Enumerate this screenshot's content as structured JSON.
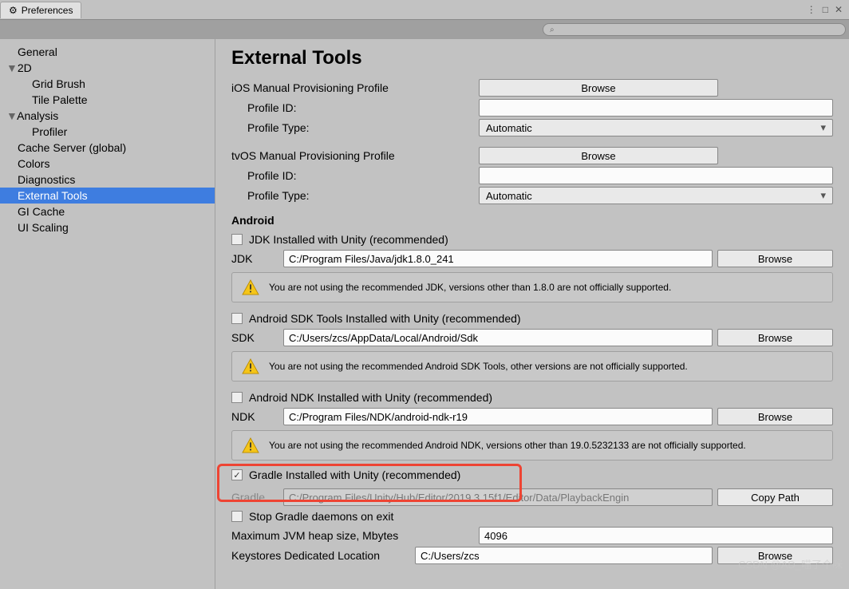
{
  "titlebar": {
    "title": "Preferences",
    "menu": "⋮",
    "max": "□",
    "close": "✕"
  },
  "search": {
    "placeholder": ""
  },
  "sidebar": {
    "items": [
      {
        "label": "General"
      },
      {
        "label": "2D",
        "fold": true
      },
      {
        "label": "Grid Brush",
        "sub": true
      },
      {
        "label": "Tile Palette",
        "sub": true
      },
      {
        "label": "Analysis",
        "fold": true
      },
      {
        "label": "Profiler",
        "sub": true
      },
      {
        "label": "Cache Server (global)"
      },
      {
        "label": "Colors"
      },
      {
        "label": "Diagnostics"
      },
      {
        "label": "External Tools",
        "selected": true
      },
      {
        "label": "GI Cache"
      },
      {
        "label": "UI Scaling"
      }
    ]
  },
  "page": {
    "title": "External Tools",
    "ios": {
      "title": "iOS Manual Provisioning Profile",
      "browse": "Browse",
      "profile_id_label": "Profile ID:",
      "profile_id": "",
      "profile_type_label": "Profile Type:",
      "profile_type": "Automatic"
    },
    "tvos": {
      "title": "tvOS Manual Provisioning Profile",
      "browse": "Browse",
      "profile_id_label": "Profile ID:",
      "profile_id": "",
      "profile_type_label": "Profile Type:",
      "profile_type": "Automatic"
    },
    "android": {
      "title": "Android",
      "jdk_cb": "JDK Installed with Unity (recommended)",
      "jdk_label": "JDK",
      "jdk_path": "C:/Program Files/Java/jdk1.8.0_241",
      "browse": "Browse",
      "jdk_warn": "You are not using the recommended JDK, versions other than 1.8.0 are not officially supported.",
      "sdk_cb": "Android SDK Tools Installed with Unity (recommended)",
      "sdk_label": "SDK",
      "sdk_path": "C:/Users/zcs/AppData/Local/Android/Sdk",
      "sdk_warn": "You are not using the recommended Android SDK Tools, other versions are not officially supported.",
      "ndk_cb": "Android NDK Installed with Unity (recommended)",
      "ndk_label": "NDK",
      "ndk_path": "C:/Program Files/NDK/android-ndk-r19",
      "ndk_warn": "You are not using the recommended Android NDK, versions other than 19.0.5232133 are not officially supported.",
      "gradle_cb": "Gradle Installed with Unity (recommended)",
      "gradle_label": "Gradle",
      "gradle_path": "C:/Program Files/Unity/Hub/Editor/2019.3.15f1/Editor/Data/PlaybackEngin",
      "copy_path": "Copy Path",
      "stop_daemons": "Stop Gradle daemons on exit",
      "heap_label": "Maximum JVM heap size, Mbytes",
      "heap": "4096",
      "keystore_label": "Keystores Dedicated Location",
      "keystore": "C:/Users/zcs"
    }
  },
  "watermark": "CSDN @AD_喵了个咪"
}
